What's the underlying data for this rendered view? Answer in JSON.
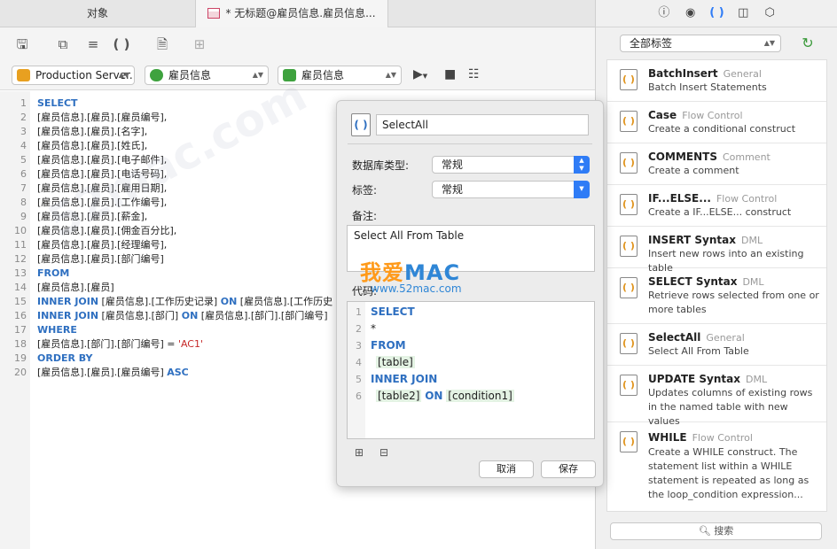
{
  "tabs": {
    "objects": "对象",
    "query": "* 无标题@雇员信息.雇员信息..."
  },
  "selectors": {
    "server": "Production Server...",
    "db1": "雇员信息",
    "db2": "雇员信息"
  },
  "editor": {
    "line_numbers": [
      "1",
      "2",
      "3",
      "4",
      "5",
      "6",
      "7",
      "8",
      "9",
      "10",
      "11",
      "12",
      "13",
      "14",
      "15",
      "16",
      "17",
      "18",
      "19",
      "20"
    ],
    "l1": "SELECT",
    "l2": "[雇员信息].[雇员].[雇员编号],",
    "l3": "[雇员信息].[雇员].[名字],",
    "l4": "[雇员信息].[雇员].[姓氏],",
    "l5": "[雇员信息].[雇员].[电子邮件],",
    "l6": "[雇员信息].[雇员].[电话号码],",
    "l7": "[雇员信息].[雇员].[雇用日期],",
    "l8": "[雇员信息].[雇员].[工作编号],",
    "l9": "[雇员信息].[雇员].[薪金],",
    "l10": "[雇员信息].[雇员].[佣金百分比],",
    "l11": "[雇员信息].[雇员].[经理编号],",
    "l12": "[雇员信息].[雇员].[部门编号]",
    "l13": "FROM",
    "l14": "[雇员信息].[雇员]",
    "l15_kw": "INNER JOIN",
    "l15_a": " [雇员信息].[工作历史记录] ",
    "l15_on": "ON",
    "l15_b": " [雇员信息].[工作历史",
    "l16_kw": "INNER JOIN",
    "l16_a": " [雇员信息].[部门] ",
    "l16_on": "ON",
    "l16_b": " [雇员信息].[部门].[部门编号]",
    "l17": "WHERE",
    "l18_a": "[雇员信息].[部门].[部门编号] = ",
    "l18_str": "'AC1'",
    "l19": "ORDER BY",
    "l20_a": "[雇员信息].[雇员].[雇员编号] ",
    "l20_kw": "ASC"
  },
  "popover": {
    "name": "SelectAll",
    "db_type_label": "数据库类型:",
    "db_type_value": "常规",
    "tag_label": "标签:",
    "tag_value": "常规",
    "memo_label": "备注:",
    "memo_value": "Select All From Table",
    "code_label": "代码:",
    "watermark_main": "我爱",
    "watermark_mac": "MAC",
    "watermark_url": "www.52mac.com",
    "code_lines": [
      "1",
      "2",
      "3",
      "4",
      "5",
      "6"
    ],
    "c1": "SELECT",
    "c2": "*",
    "c3": "FROM",
    "c4": "[table]",
    "c5": "INNER JOIN",
    "c6a": "[table2]",
    "c6on": "ON",
    "c6b": "[condition1]",
    "cancel": "取消",
    "save": "保存"
  },
  "right": {
    "filter": "全部标签",
    "search": "搜索",
    "items": [
      {
        "title": "BatchInsert",
        "cat": "General",
        "desc": "Batch Insert Statements"
      },
      {
        "title": "Case",
        "cat": "Flow Control",
        "desc": "Create a conditional construct"
      },
      {
        "title": "COMMENTS",
        "cat": "Comment",
        "desc": "Create a comment"
      },
      {
        "title": "IF...ELSE...",
        "cat": "Flow Control",
        "desc": "Create a IF...ELSE... construct"
      },
      {
        "title": "INSERT Syntax",
        "cat": "DML",
        "desc": "Insert new rows into an existing table"
      },
      {
        "title": "SELECT Syntax",
        "cat": "DML",
        "desc": "Retrieve rows selected from one or more tables"
      },
      {
        "title": "SelectAll",
        "cat": "General",
        "desc": "Select All From Table"
      },
      {
        "title": "UPDATE Syntax",
        "cat": "DML",
        "desc": "Updates columns of existing rows in the named table with new values"
      },
      {
        "title": "WHILE",
        "cat": "Flow Control",
        "desc": "Create a WHILE construct. The statement list within a WHILE statement is repeated as long as the loop_condition expression..."
      }
    ]
  },
  "bg_watermark": "52mac.com",
  "colors": {
    "keyword": "#2e6fc0",
    "string": "#c62828",
    "accent": "#2f7cf6"
  }
}
